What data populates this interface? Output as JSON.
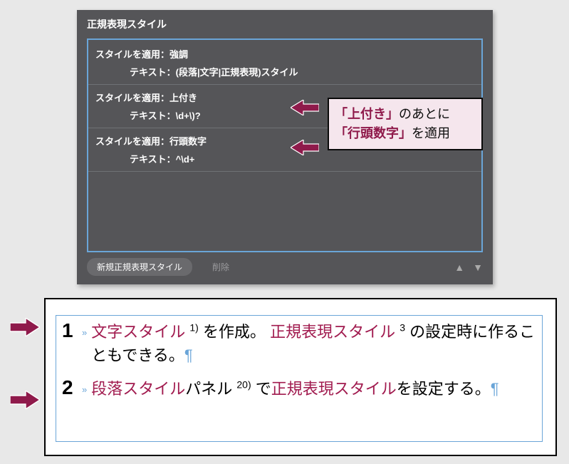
{
  "panel": {
    "title": "正規表現スタイル",
    "rules": [
      {
        "apply_label": "スタイルを適用：",
        "apply_value": "強調",
        "text_label": "テキスト：",
        "text_value": "(段落|文字|正規表現)スタイル"
      },
      {
        "apply_label": "スタイルを適用：",
        "apply_value": "上付き",
        "text_label": "テキスト：",
        "text_value": "\\d+\\)?"
      },
      {
        "apply_label": "スタイルを適用：",
        "apply_value": "行頭数字",
        "text_label": "テキスト：",
        "text_value": "^\\d+"
      }
    ],
    "new_btn": "新規正規表現スタイル",
    "delete_btn": "削除"
  },
  "annotation": {
    "line1a": "「上付き」",
    "line1b": "のあとに",
    "line2a": "「行頭数字」",
    "line2b": "を適用"
  },
  "doc": {
    "steps": [
      {
        "num": "1",
        "parts": {
          "a": "文字スタイル",
          "sup1": "1)",
          "b": "を作成。",
          "c": "正規表現スタイル",
          "sup2": "3",
          "d": "の設定時に作ることもできる。"
        }
      },
      {
        "num": "2",
        "parts": {
          "a": "段落スタイル",
          "b": "パネル",
          "sup1": "20)",
          "c": "で",
          "d": "正規表現スタイル",
          "e": "を設定する。"
        }
      }
    ],
    "pilcrow": "¶"
  }
}
